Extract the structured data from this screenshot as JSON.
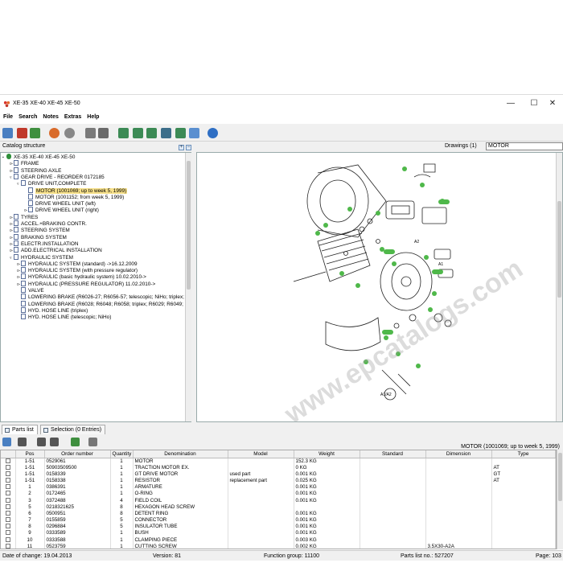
{
  "window": {
    "title": "XE-35 XE-40 XE-45 XE-50",
    "controls": [
      "—",
      "☐",
      "✕"
    ]
  },
  "menu": [
    "File",
    "Search",
    "Notes",
    "Extras",
    "Help"
  ],
  "catalog": {
    "header": "Catalog structure",
    "items": [
      {
        "label": "XE-35 XE-40 XE-45 XE-50",
        "level": 0,
        "exp": "▪",
        "doc": false
      },
      {
        "label": "FRAME",
        "level": 1,
        "exp": "⊳",
        "doc": true
      },
      {
        "label": "STEERING AXLE",
        "level": 1,
        "exp": "⊳",
        "doc": true
      },
      {
        "label": "GEAR DRIVE - REORDER 0172185",
        "level": 1,
        "exp": "▿",
        "doc": true
      },
      {
        "label": "DRIVE UNIT,COMPLETE",
        "level": 2,
        "exp": "▿",
        "doc": true
      },
      {
        "label": "MOTOR (1001069; up to week 5, 1999)",
        "level": 3,
        "exp": "",
        "doc": true,
        "selected": true
      },
      {
        "label": "MOTOR (1001152; from week 5, 1999)",
        "level": 3,
        "exp": "",
        "doc": true
      },
      {
        "label": "DRIVE WHEEL UNIT (left)",
        "level": 3,
        "exp": "",
        "doc": true
      },
      {
        "label": "DRIVE WHEEL UNIT (right)",
        "level": 3,
        "exp": "⊳",
        "doc": true
      },
      {
        "label": "TYRES",
        "level": 1,
        "exp": "⊳",
        "doc": true
      },
      {
        "label": "ACCEL.+BRAKING CONTR.",
        "level": 1,
        "exp": "⊳",
        "doc": true
      },
      {
        "label": "STEERING SYSTEM",
        "level": 1,
        "exp": "⊳",
        "doc": true
      },
      {
        "label": "BRAKING SYSTEM",
        "level": 1,
        "exp": "⊳",
        "doc": true
      },
      {
        "label": "ELECTR.INSTALLATION",
        "level": 1,
        "exp": "⊳",
        "doc": true
      },
      {
        "label": "ADD.ELECTRICAL INSTALLATION",
        "level": 1,
        "exp": "⊳",
        "doc": true
      },
      {
        "label": "HYDRAULIC SYSTEM",
        "level": 1,
        "exp": "▿",
        "doc": true
      },
      {
        "label": "HYDRAULIC SYSTEM (standard)  ->16.12.2009",
        "level": 2,
        "exp": "⊳",
        "doc": true
      },
      {
        "label": "HYDRAULIC SYSTEM (with pressure regulator)",
        "level": 2,
        "exp": "⊳",
        "doc": true
      },
      {
        "label": "HYDRAULIC (basic hydraulic system)  10.02.2010->",
        "level": 2,
        "exp": "⊳",
        "doc": true
      },
      {
        "label": "HYDRAULIC (PRESSURE REGULATOR)  11.02.2010->",
        "level": 2,
        "exp": "⊳",
        "doc": true
      },
      {
        "label": "VALVE",
        "level": 2,
        "exp": "",
        "doc": true
      },
      {
        "label": "LOWERING BRAKE (R6026-27; R6056-57; telescopic; NiHo; triplex; R6",
        "level": 2,
        "exp": "",
        "doc": true
      },
      {
        "label": "LOWERING BRAKE (R6028; R6048; R6058; triplex; R6029; R6049; R6",
        "level": 2,
        "exp": "",
        "doc": true
      },
      {
        "label": "HYD. HOSE LINE (triplex)",
        "level": 2,
        "exp": "",
        "doc": true
      },
      {
        "label": "HYD. HOSE LINE (telescopic; NiHo)",
        "level": 2,
        "exp": "",
        "doc": true
      }
    ]
  },
  "drawings": {
    "label": "Drawings (1)",
    "selected": "MOTOR",
    "callouts": [
      "A1",
      "A2",
      "A1/A2"
    ]
  },
  "tabs": [
    {
      "label": "Parts list",
      "active": true
    },
    {
      "label": "Selection (0 Entries)",
      "active": false
    }
  ],
  "parts": {
    "title": "MOTOR  (1001069; up to week 5, 1999)",
    "columns": [
      "",
      "Pos",
      "Order number",
      "Quantity",
      "Denomination",
      "Model",
      "Weight",
      "Standard",
      "Dimension",
      "Type"
    ],
    "rows": [
      [
        "1-51",
        "0529061",
        "1",
        "MOTOR",
        "",
        "152.3 KG",
        "",
        "",
        ""
      ],
      [
        "1-51",
        "50903509500",
        "1",
        "TRACTION MOTOR EX.",
        "",
        "0 KG",
        "",
        "",
        "AT"
      ],
      [
        "1-51",
        "0158339",
        "1",
        "GT DRIVE MOTOR",
        "used part",
        "0.001 KG",
        "",
        "",
        "GT"
      ],
      [
        "1-51",
        "0158338",
        "1",
        "RESISTOR",
        "replacement part",
        "0.025 KG",
        "",
        "",
        "AT"
      ],
      [
        "1",
        "0386391",
        "1",
        "ARMATURE",
        "",
        "0.001 KG",
        "",
        "",
        ""
      ],
      [
        "2",
        "0172465",
        "1",
        "O-RING",
        "",
        "0.001 KG",
        "",
        "",
        ""
      ],
      [
        "3",
        "0372488",
        "4",
        "FIELD COIL",
        "",
        "0.001 KG",
        "",
        "",
        ""
      ],
      [
        "5",
        "0218321625",
        "8",
        "HEXAGON HEAD SCREW",
        "",
        "",
        "",
        "",
        ""
      ],
      [
        "6",
        "0500951",
        "8",
        "DETENT RING",
        "",
        "0.001 KG",
        "",
        "",
        ""
      ],
      [
        "7",
        "0155859",
        "5",
        "CONNECTOR",
        "",
        "0.001 KG",
        "",
        "",
        ""
      ],
      [
        "8",
        "0296884",
        "5",
        "INSULATOR TUBE",
        "",
        "0.001 KG",
        "",
        "",
        ""
      ],
      [
        "9",
        "0333589",
        "1",
        "BUSH",
        "",
        "0.001 KG",
        "",
        "",
        ""
      ],
      [
        "10",
        "0333588",
        "1",
        "CLAMPING PIECE",
        "",
        "0.003 KG",
        "",
        "",
        ""
      ],
      [
        "11",
        "0523759",
        "1",
        "CUTTING SCREW",
        "",
        "0.002 KG",
        "",
        "3.5X30-A2A",
        ""
      ]
    ]
  },
  "status": {
    "date": "Date of change: 19.04.2013",
    "version": "Version: 81",
    "function_group": "Function group: 11100",
    "parts_list_no": "Parts list no.: 527207",
    "page": "Page: 103"
  },
  "watermark": "www.epcatalogs.com",
  "colors": {
    "accent_green": "#4fb84a",
    "selection": "#f6e08a",
    "window_bg": "#f0f0f0"
  }
}
